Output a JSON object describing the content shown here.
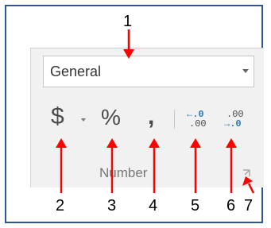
{
  "number_group": {
    "format_dropdown": {
      "value": "General"
    },
    "buttons": {
      "currency": "$",
      "percent": "%",
      "comma": ",",
      "increase_decimal": {
        "top": "←.0",
        "bottom": ".00"
      },
      "decrease_decimal": {
        "top": ".00",
        "bottom": "→.0"
      }
    },
    "label": "Number"
  },
  "callouts": [
    "1",
    "2",
    "3",
    "4",
    "5",
    "6",
    "7"
  ],
  "colors": {
    "frame": "#2b5797",
    "arrow": "#ff0000",
    "group_bg": "#f1f1f1",
    "decimal_arrow": "#2e75b6"
  },
  "icons": {
    "dropdown": "chevron-down-icon",
    "dialog_launcher": "dialog-launcher-icon"
  }
}
